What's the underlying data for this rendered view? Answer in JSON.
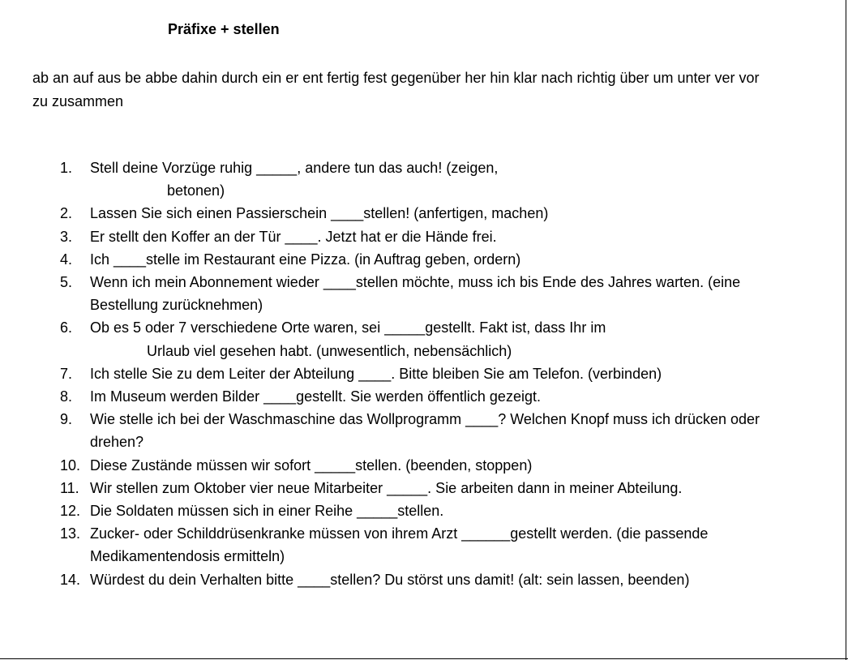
{
  "document": {
    "title": "Präfixe + stellen",
    "prefixes": "ab an auf aus be abbe dahin durch ein er ent fertig fest gegenüber her hin klar nach richtig über um unter ver vor zu zusammen",
    "exercises": [
      {
        "num": "1.",
        "line1": "Stell deine Vorzüge ruhig _____, andere tun das auch! (zeigen,",
        "line2": "betonen)"
      },
      {
        "num": "2.",
        "text": "Lassen Sie sich einen Passierschein ____stellen! (anfertigen, machen)"
      },
      {
        "num": "3.",
        "text": "Er stellt den Koffer an der Tür ____. Jetzt hat er die Hände frei."
      },
      {
        "num": "4.",
        "text": "Ich ____stelle im Restaurant eine Pizza. (in Auftrag geben, ordern)"
      },
      {
        "num": "5.",
        "text": "Wenn ich mein Abonnement wieder ____stellen möchte, muss ich bis Ende des Jahres warten. (eine Bestellung zurücknehmen)"
      },
      {
        "num": "6.",
        "line1": "Ob es 5 oder 7 verschiedene Orte waren, sei _____gestellt. Fakt ist, dass Ihr im",
        "line2": "Urlaub viel gesehen habt. (unwesentlich, nebensächlich)"
      },
      {
        "num": "7.",
        "text": "Ich stelle Sie zu dem Leiter der Abteilung ____. Bitte bleiben Sie am Telefon. (verbinden)"
      },
      {
        "num": "8.",
        "text": "Im Museum werden Bilder ____gestellt. Sie werden öffentlich gezeigt."
      },
      {
        "num": "9.",
        "text": "Wie stelle ich bei der Waschmaschine das Wollprogramm ____? Welchen Knopf muss ich drücken oder drehen?"
      },
      {
        "num": "10.",
        "text": "Diese Zustände müssen wir sofort _____stellen. (beenden, stoppen)"
      },
      {
        "num": "11.",
        "text": "Wir stellen zum Oktober vier neue Mitarbeiter _____. Sie arbeiten dann in meiner Abteilung."
      },
      {
        "num": "12.",
        "text": "Die Soldaten müssen sich in einer Reihe _____stellen."
      },
      {
        "num": "13.",
        "text": "Zucker- oder Schilddrüsenkranke müssen von ihrem Arzt ______gestellt werden. (die passende Medikamentendosis ermitteln)"
      },
      {
        "num": "14.",
        "text": "Würdest du dein Verhalten bitte ____stellen? Du störst uns damit! (alt: sein lassen, beenden)"
      }
    ]
  }
}
